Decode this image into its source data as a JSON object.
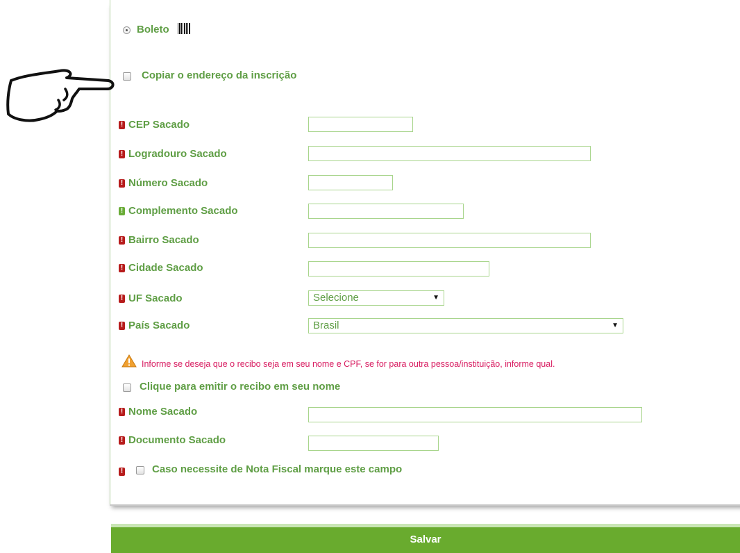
{
  "payment": {
    "option_label": "Boleto"
  },
  "copy_address": {
    "label": "Copiar o endereço da inscrição"
  },
  "fields": [
    {
      "label": "CEP Sacado"
    },
    {
      "label": "Logradouro Sacado"
    },
    {
      "label": "Número Sacado"
    },
    {
      "label": "Complemento Sacado"
    },
    {
      "label": "Bairro Sacado"
    },
    {
      "label": "Cidade Sacado"
    },
    {
      "label": "UF Sacado",
      "value": "Selecione"
    },
    {
      "label": "País Sacado",
      "value": "Brasil"
    }
  ],
  "notice": {
    "text": "Informe se deseja que o recibo seja em seu nome e CPF, se for para outra pessoa/instituição, informe qual."
  },
  "receipt": {
    "label": "Clique para emitir o recibo em seu nome"
  },
  "receipt_fields": [
    {
      "label": "Nome Sacado"
    },
    {
      "label": "Documento Sacado"
    }
  ],
  "invoice": {
    "label": "Caso necessite de Nota Fiscal marque este campo"
  },
  "save": {
    "label": "Salvar"
  },
  "colors": {
    "label_green": "#5f9e45",
    "required_red": "#b71c1c",
    "optional_green": "#6aac38",
    "button_green": "#69ab2e",
    "notice_pink": "#d81b60"
  },
  "icons": {
    "required": "exclamation-icon",
    "warning": "warning-triangle-icon",
    "pointer": "pointing-hand-icon",
    "barcode": "barcode-icon"
  }
}
